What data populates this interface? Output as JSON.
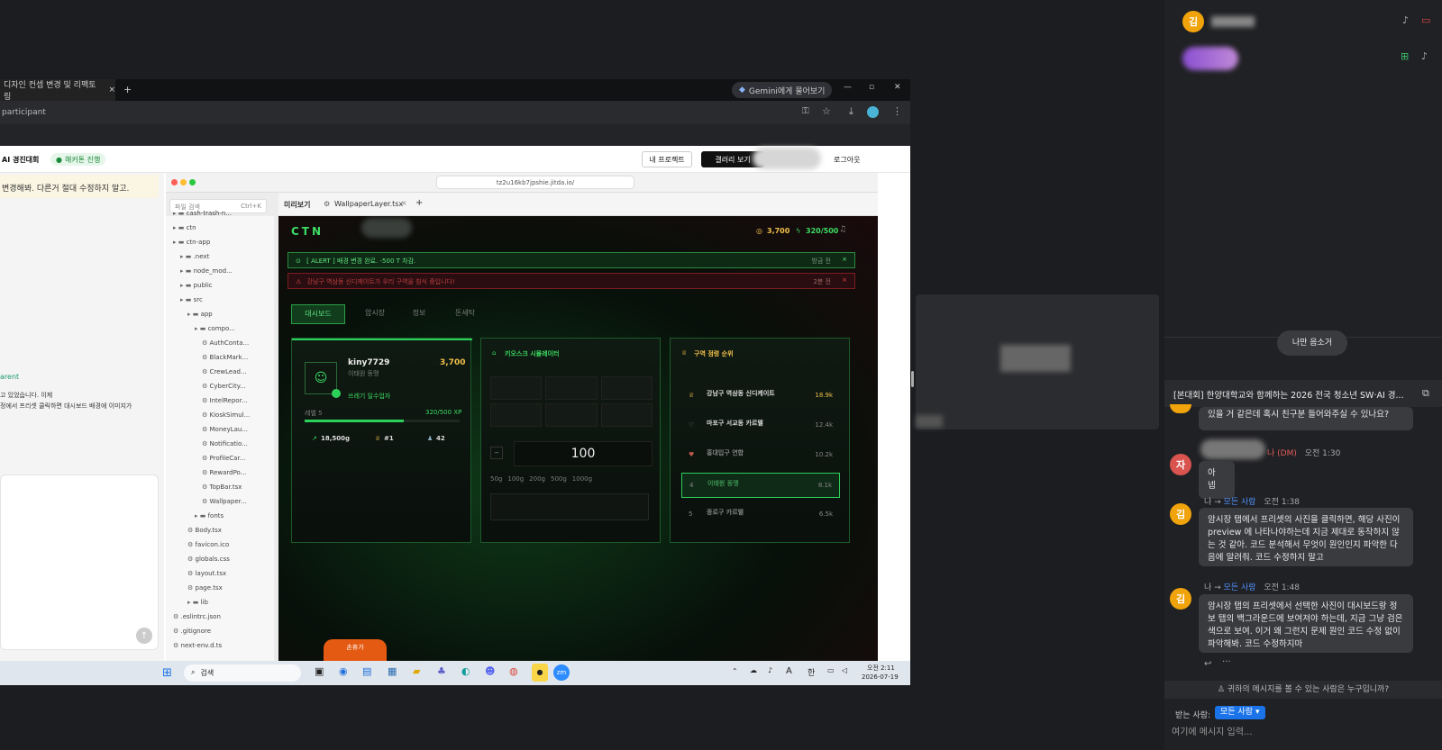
{
  "browser": {
    "tab_title": "디자인 컨셉 변경 및 리팩토링",
    "tab_close": "×",
    "new_tab": "+",
    "gemini": "Gemini에게 물어보기",
    "address": "participant"
  },
  "site": {
    "brand": "AI 경진대회",
    "status": "해커톤 진행",
    "my_project": "내 프로젝트",
    "gallery": "갤러리 보기",
    "logout": "로그아웃"
  },
  "chat_note": "변경해봐. 다른거 절대 수정하지 말고.",
  "left_fragments": [
    "arent",
    "고 있었습니다. 이제",
    "정에서 프리셋 클릭하면 대시보드 배경에 이미지가"
  ],
  "ide": {
    "url": "tz2u16kb7jpshie.jitda.io/",
    "search_placeholder": "파일 검색",
    "search_shortcut": "Ctrl+K",
    "tab_preview": "미리보기",
    "tab_file": "WallpaperLayer.tsx",
    "files": [
      "cash-trash-n...",
      "ctn",
      "ctn-app",
      ".next",
      "node_mod...",
      "public",
      "src",
      "app",
      "compo...",
      "AuthConta...",
      "BlackMark...",
      "CrewLead...",
      "CyberCity...",
      "IntelRepor...",
      "KioskSimul...",
      "MoneyLau...",
      "Notificatio...",
      "ProfileCar...",
      "RewardPo...",
      "TopBar.tsx",
      "Wallpaper...",
      "fonts",
      "Body.tsx",
      "favicon.ico",
      "globals.css",
      "layout.tsx",
      "page.tsx",
      "lib",
      ".eslintrc.json",
      ".gitignore",
      "next-env.d.ts"
    ]
  },
  "app": {
    "logo": "CTN",
    "gold": "3,700",
    "xp": "320/500",
    "alert1": "[ ALERT ] 배경 변경 완료. -500 T 차감.",
    "alert1_time": "방금 전",
    "alert2": "강남구 역삼동 신디케이트가 우리 구역을 침식 중입니다!",
    "alert2_time": "2분 전",
    "tabs": [
      "대시보드",
      "암시장",
      "정보",
      "돈세탁"
    ],
    "profile": {
      "name": "kiny7729",
      "gold": "3,700",
      "crew": "이태원 동맹",
      "rank": "쓰레기 일수업자",
      "level": "레벨 5",
      "xp": "320/500 XP",
      "xp_pct": 64,
      "stat1": "18,500g",
      "stat2": "#1",
      "stat3": "42"
    },
    "kiosk": {
      "title": "키오스크 시뮬레이터",
      "weight": "100",
      "presets": [
        "50g",
        "100g",
        "200g",
        "500g",
        "1000g"
      ]
    },
    "ranking": {
      "title": "구역 점령 순위",
      "rows": [
        {
          "name": "강남구 역삼동 신디케이트",
          "value": "18.9k"
        },
        {
          "name": "마포구 서교동 카르텔",
          "value": "12.4k"
        },
        {
          "name": "홍대입구 연합",
          "value": "10.2k"
        },
        {
          "name": "이태원 동맹",
          "value": "8.1k"
        },
        {
          "name": "종로구 카르텔",
          "value": "6.5k"
        }
      ]
    },
    "bottom_tab": "손휴가"
  },
  "taskbar": {
    "search": "검색",
    "time": "오전 2:11",
    "date": "2026-07-19",
    "lang": "한",
    "ime": "A"
  },
  "meeting": {
    "mute_me": "나만 음소거",
    "chat_title": "[본대회] 한양대학교와 함께하는 2026 전국 청소년 SW·AI 경...",
    "msg0": "있을 거 같은데 혹시 친구분 들어와주실 수 있나요?",
    "dm_label": "나 (DM)",
    "dm_time": "오전 1:30",
    "dm_text": "아 넵",
    "m1_from": "나 → ",
    "m1_to": "모든 사람",
    "m1_time": "오전 1:38",
    "m1_text": "암시장 탭에서 프리셋의 사진을 클릭하면, 해당 사진이 preview 에 나타나야하는데 지금 제대로 동작하지 않는 것 같아. 코드 분석해서 무엇이 원인인지 파악한 다음에 알려줘. 코드 수정하지 말고",
    "m2_from": "나 → ",
    "m2_to": "모든 사람",
    "m2_time": "오전 1:48",
    "m2_text": "암시장 탭의 프리셋에서 선택한 사진이 대시보드랑 정보 탭의 백그라운드에 보여져야 하는데, 지금 그냥 검은색으로 보여. 이거 왜 그런지 문제 원인 코드 수정 없이 파악해봐. 코드 수정하지마",
    "who_sees": "귀하의 메시지를 볼 수 있는 사람은 누구입니까?",
    "to_label": "받는 사람:",
    "to_value": "모든 사람",
    "input_placeholder": "여기에 메시지 입력...",
    "av_kim": "김",
    "av_ja": "자"
  }
}
